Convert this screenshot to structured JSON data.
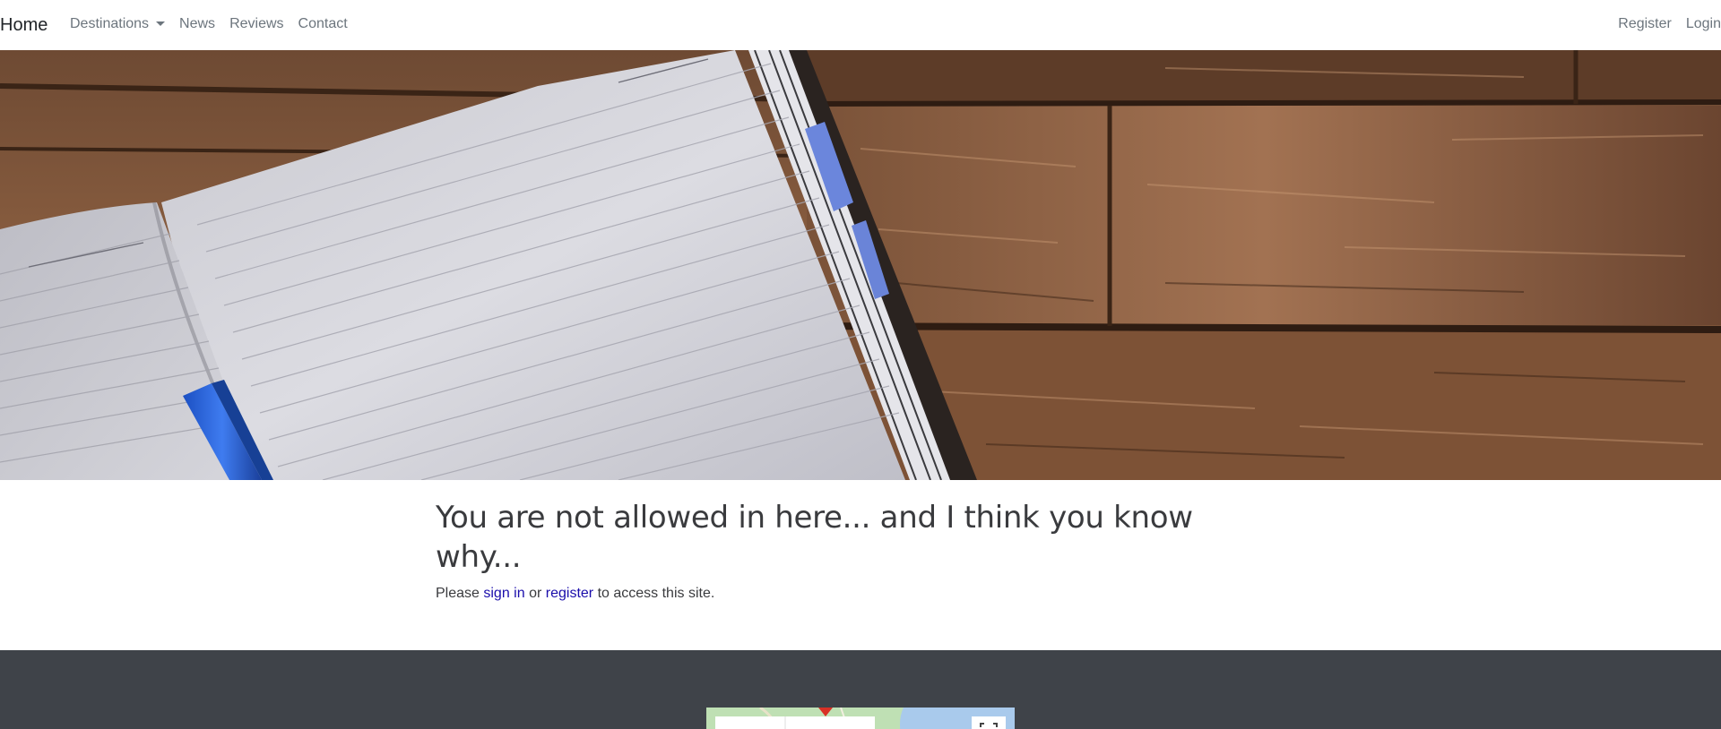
{
  "navbar": {
    "brand": "Home",
    "left_items": [
      {
        "label": "Destinations",
        "dropdown": true
      },
      {
        "label": "News"
      },
      {
        "label": "Reviews"
      },
      {
        "label": "Contact"
      }
    ],
    "right_items": [
      {
        "label": "Register"
      },
      {
        "label": "Login"
      }
    ]
  },
  "hero": {
    "image_subject": "open notebook with blue pen on wooden desk"
  },
  "main": {
    "heading": "You are not allowed in here... and I think you know why...",
    "para_prefix": "Please",
    "sign_in_link": "sign in",
    "para_middle": "or",
    "register_link": "register",
    "para_suffix": "to access this site."
  },
  "footer": {
    "map_thumbnail": "embedded map preview"
  },
  "colors": {
    "nav_text": "#6c757d",
    "brand_text": "#212529",
    "link": "#1a0dab",
    "footer_bg": "#3f4349"
  }
}
